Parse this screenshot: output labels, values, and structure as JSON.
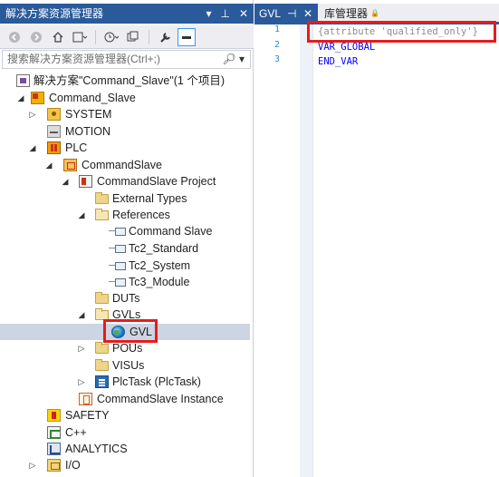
{
  "solution_explorer": {
    "title": "解决方案资源管理器",
    "title_controls": [
      "▾",
      "⊥",
      "✕"
    ],
    "search_placeholder": "搜索解决方案资源管理器(Ctrl+;)",
    "search_icon": "search-icon",
    "tree": [
      {
        "label": "解决方案\"Command_Slave\"(1 个项目)",
        "icon": "solution-icon",
        "expander": ""
      },
      {
        "label": "Command_Slave",
        "icon": "twincat-project-icon",
        "expander": "◢"
      },
      {
        "label": "SYSTEM",
        "icon": "system-icon",
        "expander": "▷"
      },
      {
        "label": "MOTION",
        "icon": "motion-icon",
        "expander": ""
      },
      {
        "label": "PLC",
        "icon": "plc-icon",
        "expander": "◢"
      },
      {
        "label": "CommandSlave",
        "icon": "plc-project-icon",
        "expander": "◢"
      },
      {
        "label": "CommandSlave Project",
        "icon": "plc-project-file-icon",
        "expander": "◢"
      },
      {
        "label": "External Types",
        "icon": "folder-icon",
        "expander": ""
      },
      {
        "label": "References",
        "icon": "folder-open-icon",
        "expander": "◢"
      },
      {
        "label": "Command Slave",
        "icon": "reference-icon",
        "expander": ""
      },
      {
        "label": "Tc2_Standard",
        "icon": "reference-icon",
        "expander": ""
      },
      {
        "label": "Tc2_System",
        "icon": "reference-icon",
        "expander": ""
      },
      {
        "label": "Tc3_Module",
        "icon": "reference-icon",
        "expander": ""
      },
      {
        "label": "DUTs",
        "icon": "folder-icon",
        "expander": ""
      },
      {
        "label": "GVLs",
        "icon": "folder-open-icon",
        "expander": "◢"
      },
      {
        "label": "GVL",
        "icon": "gvl-icon",
        "expander": "",
        "selected": true
      },
      {
        "label": "POUs",
        "icon": "folder-icon",
        "expander": "▷"
      },
      {
        "label": "VISUs",
        "icon": "folder-icon",
        "expander": ""
      },
      {
        "label": "PlcTask (PlcTask)",
        "icon": "task-icon",
        "expander": "▷"
      },
      {
        "label": "CommandSlave Instance",
        "icon": "instance-icon",
        "expander": ""
      },
      {
        "label": "SAFETY",
        "icon": "safety-icon",
        "expander": ""
      },
      {
        "label": "C++",
        "icon": "cpp-icon",
        "expander": ""
      },
      {
        "label": "ANALYTICS",
        "icon": "analytics-icon",
        "expander": ""
      },
      {
        "label": "I/O",
        "icon": "io-icon",
        "expander": "▷"
      }
    ]
  },
  "editor": {
    "tabs": [
      {
        "label": "GVL",
        "pin": "⊣",
        "close": "✕",
        "active": true
      },
      {
        "label": "库管理器",
        "lock": "🔒",
        "active": false
      }
    ],
    "lines": [
      {
        "number": "1",
        "text": "{attribute 'qualified_only'}",
        "color": "#8c8c8c"
      },
      {
        "number": "2",
        "text": "VAR_GLOBAL",
        "color": "#0000ff"
      },
      {
        "number": "3",
        "text": "END_VAR",
        "color": "#0000ff"
      }
    ]
  },
  "colors": {
    "accent": "#2a5a9a",
    "highlight_box": "#e51c1c",
    "selection": "#cdd4e3"
  }
}
